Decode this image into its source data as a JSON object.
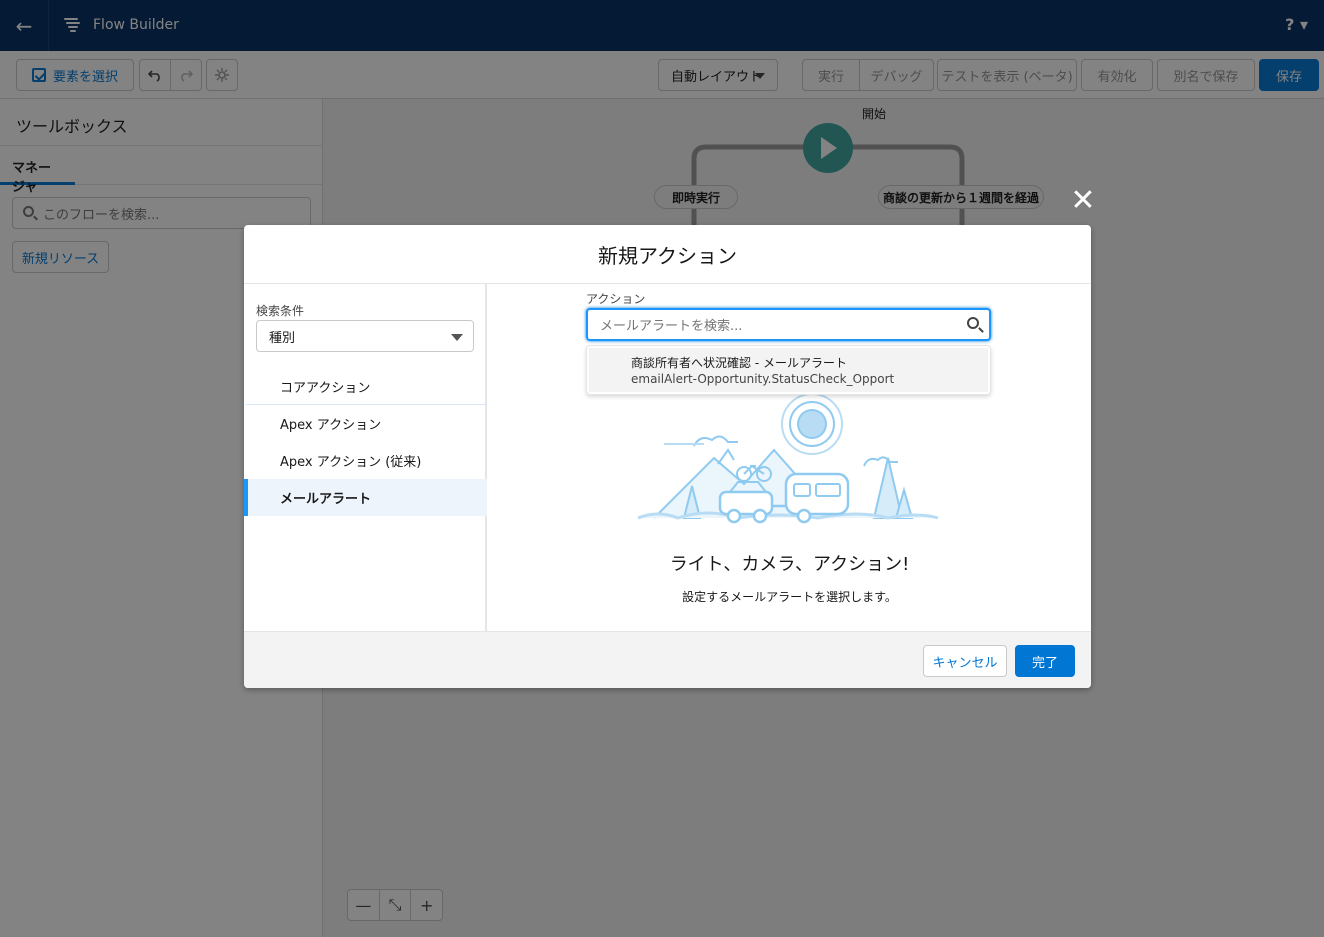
{
  "header": {
    "app_title": "Flow Builder",
    "help_label": "? ▾"
  },
  "toolbar": {
    "select_elements_label": "要素を選択",
    "layout_value": "自動レイアウト",
    "run_label": "実行",
    "debug_label": "デバッグ",
    "test_label": "テストを表示 (ベータ)",
    "activate_label": "有効化",
    "save_as_label": "別名で保存",
    "save_label": "保存"
  },
  "toolbox": {
    "title": "ツールボックス",
    "tab_manager": "マネージャ",
    "search_placeholder": "このフローを検索...",
    "new_resource_label": "新規リソース"
  },
  "canvas": {
    "start_label": "開始",
    "branch_immediate": "即時実行",
    "branch_scheduled": "商談の更新から１週間を経過",
    "zoom_out": "—",
    "zoom_fit": "⤡",
    "zoom_in": "+"
  },
  "modal": {
    "title": "新規アクション",
    "filter_label": "検索条件",
    "filter_value": "種別",
    "categories": [
      {
        "label": "コアアクション"
      },
      {
        "label": "Apex アクション"
      },
      {
        "label": "Apex アクション (従来)"
      },
      {
        "label": "メールアラート"
      }
    ],
    "action_label": "アクション",
    "action_placeholder": "メールアラートを検索...",
    "result_line1": "商談所有者へ状況確認 - メールアラート",
    "result_line2": "emailAlert-Opportunity.StatusCheck_Opport",
    "empty_title": "ライト、カメラ、アクション!",
    "empty_sub": "設定するメールアラートを選択します。",
    "cancel_label": "キャンセル",
    "done_label": "完了",
    "close_icon": "✕"
  },
  "colors": {
    "brand": "#0176d3",
    "header_bg": "#032d60",
    "start_node": "#3ba59d",
    "illustration": "#8fcaf0"
  }
}
